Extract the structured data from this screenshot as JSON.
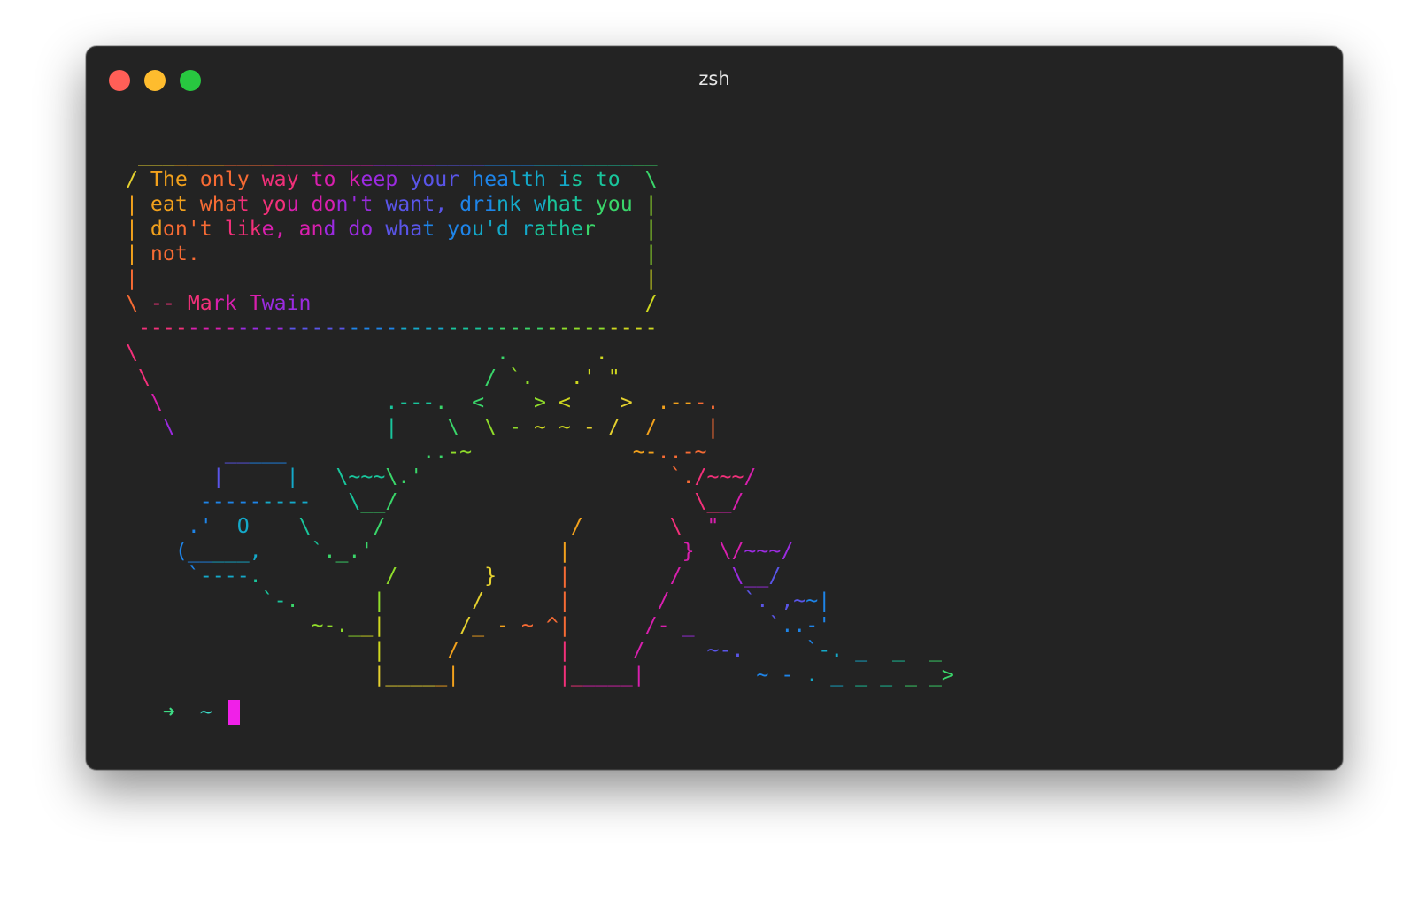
{
  "window": {
    "title": "zsh"
  },
  "terminal": {
    "lines": [
      "  __________________________________________",
      " / The only way to keep your health is to  \\",
      " | eat what you don't want, drink what you |",
      " | don't like, and do what you'd rather    |",
      " | not.                                    |",
      " |                                         |",
      " \\ -- Mark Twain                           /",
      "  ------------------------------------------",
      " \\                             .       .",
      "  \\                           / `.   .' \"",
      "   \\                  .---.  <    > <    >  .---.",
      "    \\                 |    \\  \\ - ~ ~ - /  /    |",
      "         _____           ..-~             ~-..-~",
      "        |     |   \\~~~\\.'                    `./~~~/",
      "       ---------   \\__/                        \\__/",
      "      .'  O    \\     /               /       \\  \"",
      "     (_____,    `._.'               |         }  \\/~~~/",
      "      `----.          /       }     |        /    \\__/",
      "            `-.      |       /      |       /      `. ,~~|",
      "                ~-.__|      /_ - ~ ^|      /- _      `..-'",
      "                     |     /        |     /     ~-.     `-. _  _  _",
      "                     |_____|        |_____|         ~ - . _ _ _ _ _>"
    ],
    "palette": [
      "#e5d12f",
      "#f2a11c",
      "#f76b34",
      "#f2307a",
      "#d81fae",
      "#9b2be0",
      "#5a55e8",
      "#1e84e8",
      "#14a9c9",
      "#19c59c",
      "#3ad66a",
      "#8fdc2a",
      "#cfd81f"
    ],
    "prompt": {
      "arrow": "➜",
      "cwd": "~"
    },
    "colors": {
      "cursor": "#f020e8",
      "arrow": "#3ddc84",
      "cwd": "#3ddcc9",
      "background": "#232323"
    }
  }
}
